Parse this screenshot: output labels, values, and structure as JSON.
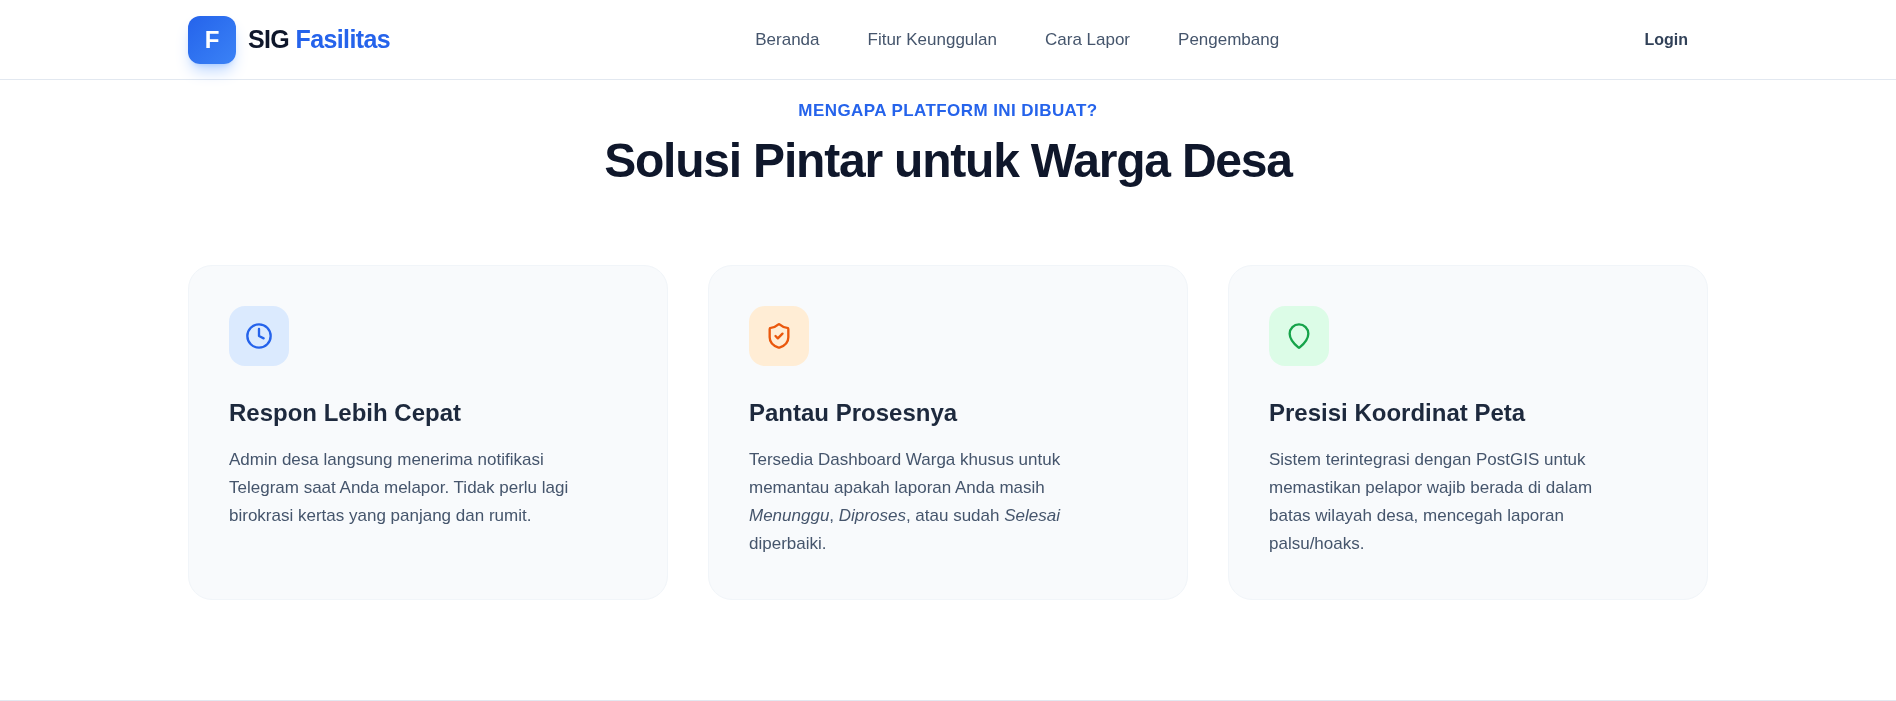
{
  "header": {
    "logo": {
      "mark": "F",
      "prefix": "SIG",
      "highlight": "Fasilitas"
    },
    "nav": [
      "Beranda",
      "Fitur Keunggulan",
      "Cara Lapor",
      "Pengembang"
    ],
    "login": "Login"
  },
  "section": {
    "eyebrow": "MENGAPA PLATFORM INI DIBUAT?",
    "title": "Solusi Pintar untuk Warga Desa",
    "cards": [
      {
        "title": "Respon Lebih Cepat",
        "description": "Admin desa langsung menerima notifikasi Telegram saat Anda melapor. Tidak perlu lagi birokrasi kertas yang panjang dan rumit."
      },
      {
        "title": "Pantau Prosesnya",
        "description": "Tersedia Dashboard Warga khusus untuk memantau apakah laporan Anda masih *Menunggu*, *Diproses*, atau sudah *Selesai* diperbaiki."
      },
      {
        "title": "Presisi Koordinat Peta",
        "description": "Sistem terintegrasi dengan PostGIS untuk memastikan pelapor wajib berada di dalam batas wilayah desa, mencegah laporan palsu/hoaks."
      }
    ]
  }
}
